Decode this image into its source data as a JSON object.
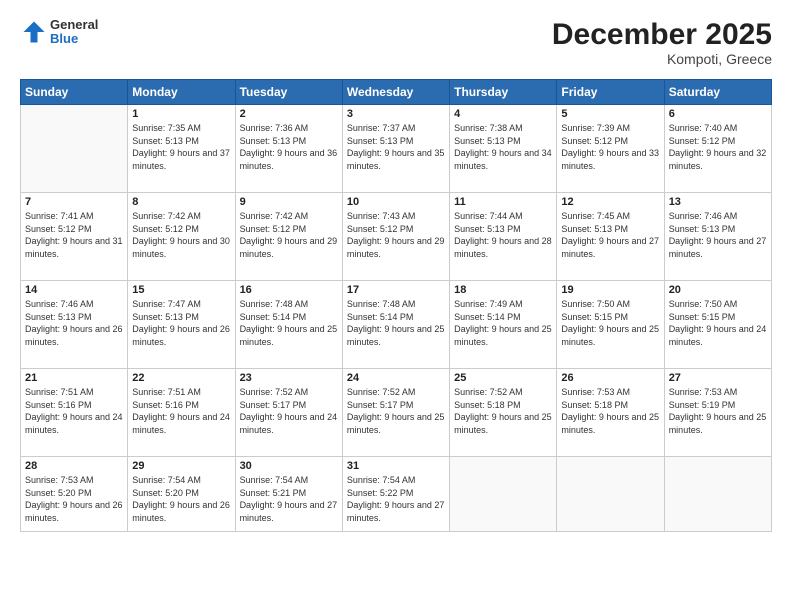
{
  "header": {
    "logo_general": "General",
    "logo_blue": "Blue",
    "month_title": "December 2025",
    "location": "Kompoti, Greece"
  },
  "weekdays": [
    "Sunday",
    "Monday",
    "Tuesday",
    "Wednesday",
    "Thursday",
    "Friday",
    "Saturday"
  ],
  "weeks": [
    [
      {
        "day": "",
        "sunrise": "",
        "sunset": "",
        "daylight": ""
      },
      {
        "day": "1",
        "sunrise": "Sunrise: 7:35 AM",
        "sunset": "Sunset: 5:13 PM",
        "daylight": "Daylight: 9 hours and 37 minutes."
      },
      {
        "day": "2",
        "sunrise": "Sunrise: 7:36 AM",
        "sunset": "Sunset: 5:13 PM",
        "daylight": "Daylight: 9 hours and 36 minutes."
      },
      {
        "day": "3",
        "sunrise": "Sunrise: 7:37 AM",
        "sunset": "Sunset: 5:13 PM",
        "daylight": "Daylight: 9 hours and 35 minutes."
      },
      {
        "day": "4",
        "sunrise": "Sunrise: 7:38 AM",
        "sunset": "Sunset: 5:13 PM",
        "daylight": "Daylight: 9 hours and 34 minutes."
      },
      {
        "day": "5",
        "sunrise": "Sunrise: 7:39 AM",
        "sunset": "Sunset: 5:12 PM",
        "daylight": "Daylight: 9 hours and 33 minutes."
      },
      {
        "day": "6",
        "sunrise": "Sunrise: 7:40 AM",
        "sunset": "Sunset: 5:12 PM",
        "daylight": "Daylight: 9 hours and 32 minutes."
      }
    ],
    [
      {
        "day": "7",
        "sunrise": "Sunrise: 7:41 AM",
        "sunset": "Sunset: 5:12 PM",
        "daylight": "Daylight: 9 hours and 31 minutes."
      },
      {
        "day": "8",
        "sunrise": "Sunrise: 7:42 AM",
        "sunset": "Sunset: 5:12 PM",
        "daylight": "Daylight: 9 hours and 30 minutes."
      },
      {
        "day": "9",
        "sunrise": "Sunrise: 7:42 AM",
        "sunset": "Sunset: 5:12 PM",
        "daylight": "Daylight: 9 hours and 29 minutes."
      },
      {
        "day": "10",
        "sunrise": "Sunrise: 7:43 AM",
        "sunset": "Sunset: 5:12 PM",
        "daylight": "Daylight: 9 hours and 29 minutes."
      },
      {
        "day": "11",
        "sunrise": "Sunrise: 7:44 AM",
        "sunset": "Sunset: 5:13 PM",
        "daylight": "Daylight: 9 hours and 28 minutes."
      },
      {
        "day": "12",
        "sunrise": "Sunrise: 7:45 AM",
        "sunset": "Sunset: 5:13 PM",
        "daylight": "Daylight: 9 hours and 27 minutes."
      },
      {
        "day": "13",
        "sunrise": "Sunrise: 7:46 AM",
        "sunset": "Sunset: 5:13 PM",
        "daylight": "Daylight: 9 hours and 27 minutes."
      }
    ],
    [
      {
        "day": "14",
        "sunrise": "Sunrise: 7:46 AM",
        "sunset": "Sunset: 5:13 PM",
        "daylight": "Daylight: 9 hours and 26 minutes."
      },
      {
        "day": "15",
        "sunrise": "Sunrise: 7:47 AM",
        "sunset": "Sunset: 5:13 PM",
        "daylight": "Daylight: 9 hours and 26 minutes."
      },
      {
        "day": "16",
        "sunrise": "Sunrise: 7:48 AM",
        "sunset": "Sunset: 5:14 PM",
        "daylight": "Daylight: 9 hours and 25 minutes."
      },
      {
        "day": "17",
        "sunrise": "Sunrise: 7:48 AM",
        "sunset": "Sunset: 5:14 PM",
        "daylight": "Daylight: 9 hours and 25 minutes."
      },
      {
        "day": "18",
        "sunrise": "Sunrise: 7:49 AM",
        "sunset": "Sunset: 5:14 PM",
        "daylight": "Daylight: 9 hours and 25 minutes."
      },
      {
        "day": "19",
        "sunrise": "Sunrise: 7:50 AM",
        "sunset": "Sunset: 5:15 PM",
        "daylight": "Daylight: 9 hours and 25 minutes."
      },
      {
        "day": "20",
        "sunrise": "Sunrise: 7:50 AM",
        "sunset": "Sunset: 5:15 PM",
        "daylight": "Daylight: 9 hours and 24 minutes."
      }
    ],
    [
      {
        "day": "21",
        "sunrise": "Sunrise: 7:51 AM",
        "sunset": "Sunset: 5:16 PM",
        "daylight": "Daylight: 9 hours and 24 minutes."
      },
      {
        "day": "22",
        "sunrise": "Sunrise: 7:51 AM",
        "sunset": "Sunset: 5:16 PM",
        "daylight": "Daylight: 9 hours and 24 minutes."
      },
      {
        "day": "23",
        "sunrise": "Sunrise: 7:52 AM",
        "sunset": "Sunset: 5:17 PM",
        "daylight": "Daylight: 9 hours and 24 minutes."
      },
      {
        "day": "24",
        "sunrise": "Sunrise: 7:52 AM",
        "sunset": "Sunset: 5:17 PM",
        "daylight": "Daylight: 9 hours and 25 minutes."
      },
      {
        "day": "25",
        "sunrise": "Sunrise: 7:52 AM",
        "sunset": "Sunset: 5:18 PM",
        "daylight": "Daylight: 9 hours and 25 minutes."
      },
      {
        "day": "26",
        "sunrise": "Sunrise: 7:53 AM",
        "sunset": "Sunset: 5:18 PM",
        "daylight": "Daylight: 9 hours and 25 minutes."
      },
      {
        "day": "27",
        "sunrise": "Sunrise: 7:53 AM",
        "sunset": "Sunset: 5:19 PM",
        "daylight": "Daylight: 9 hours and 25 minutes."
      }
    ],
    [
      {
        "day": "28",
        "sunrise": "Sunrise: 7:53 AM",
        "sunset": "Sunset: 5:20 PM",
        "daylight": "Daylight: 9 hours and 26 minutes."
      },
      {
        "day": "29",
        "sunrise": "Sunrise: 7:54 AM",
        "sunset": "Sunset: 5:20 PM",
        "daylight": "Daylight: 9 hours and 26 minutes."
      },
      {
        "day": "30",
        "sunrise": "Sunrise: 7:54 AM",
        "sunset": "Sunset: 5:21 PM",
        "daylight": "Daylight: 9 hours and 27 minutes."
      },
      {
        "day": "31",
        "sunrise": "Sunrise: 7:54 AM",
        "sunset": "Sunset: 5:22 PM",
        "daylight": "Daylight: 9 hours and 27 minutes."
      },
      {
        "day": "",
        "sunrise": "",
        "sunset": "",
        "daylight": ""
      },
      {
        "day": "",
        "sunrise": "",
        "sunset": "",
        "daylight": ""
      },
      {
        "day": "",
        "sunrise": "",
        "sunset": "",
        "daylight": ""
      }
    ]
  ]
}
